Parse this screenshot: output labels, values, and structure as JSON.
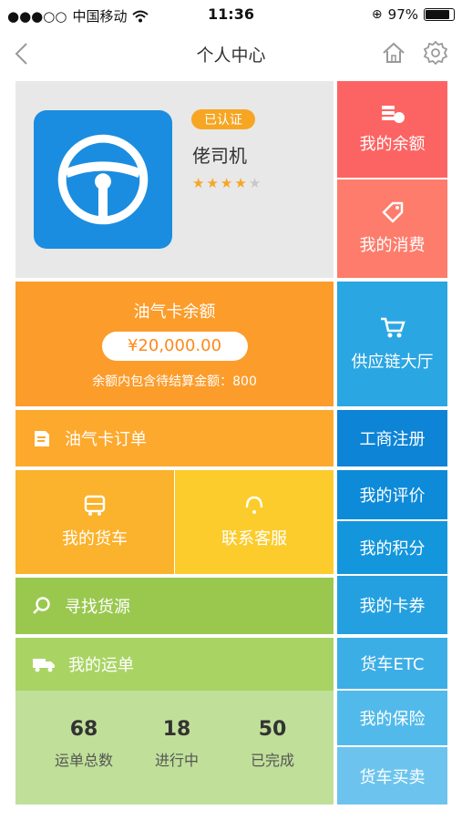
{
  "status_bar": {
    "carrier": "中国移动",
    "time": "11:36",
    "battery": "97%"
  },
  "nav": {
    "title": "个人中心",
    "icons": [
      "back-icon",
      "home-icon",
      "gear-icon"
    ]
  },
  "profile": {
    "badge": "已认证",
    "name": "佬司机",
    "rating": 4,
    "rating_max": 5,
    "avatar_icon": "steering-wheel-icon"
  },
  "right_menu": {
    "balance": "我的余额",
    "consumption": "我的消费",
    "supply_chain": "供应链大厅",
    "business_reg": "工商注册",
    "my_review": "我的评价",
    "my_points": "我的积分",
    "my_coupons": "我的卡券",
    "truck_etc": "货车ETC",
    "my_insurance": "我的保险",
    "truck_trade": "货车买卖"
  },
  "fuel_card": {
    "title": "油气卡余额",
    "amount": "¥20,000.00",
    "note": "余额内包含待结算金额：800",
    "orders_label": "油气卡订单"
  },
  "tiles": {
    "my_truck": "我的货车",
    "customer_service": "联系客服",
    "find_cargo": "寻找货源",
    "my_waybill": "我的运单"
  },
  "waybill_stats": [
    {
      "value": "68",
      "label": "运单总数"
    },
    {
      "value": "18",
      "label": "进行中"
    },
    {
      "value": "50",
      "label": "已完成"
    }
  ],
  "colors": {
    "red": "#fc6463",
    "salmon": "#fd7c6b",
    "orange": "#fc9c2a",
    "amber": "#fbb22c",
    "yellow": "#fbcc2c",
    "green": "#9ac84f",
    "light_green": "#c0e099",
    "blue": "#1a9ae0"
  }
}
